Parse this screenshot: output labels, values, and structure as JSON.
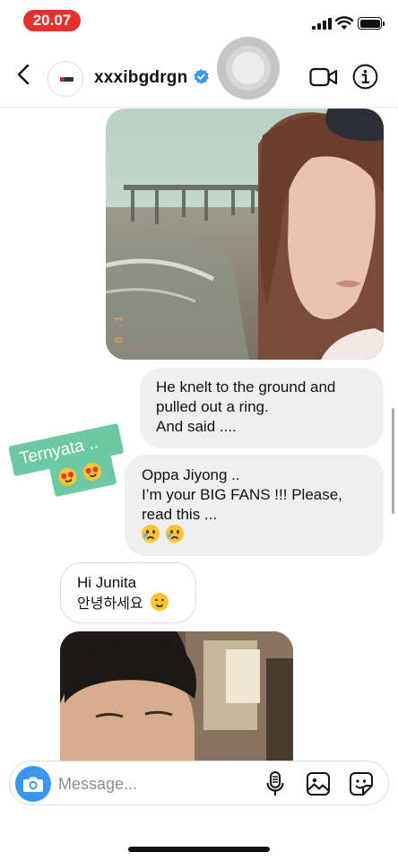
{
  "status_bar": {
    "time": "20.07",
    "icons": [
      "cellular-signal-icon",
      "wifi-icon",
      "battery-icon"
    ]
  },
  "header": {
    "username": "xxxibgdrgn",
    "verified": true,
    "icons": [
      "back-chevron-icon",
      "verified-badge-icon",
      "video-call-icon",
      "info-icon"
    ]
  },
  "messages": {
    "photo_1": {
      "type": "image",
      "description_icon": "photo-message",
      "stamp": "8 .1"
    },
    "bubble_1": {
      "line1": "He knelt to the ground and",
      "line2": "pulled out a ring.",
      "line3": "And said ...."
    },
    "sticker": {
      "text": "Ternyata ..",
      "emoji": [
        "heart-eyes",
        "heart-eyes"
      ]
    },
    "bubble_2": {
      "line1": "Oppa Jiyong ..",
      "line2": "I’m your BIG FANS !!! Please,",
      "line3": "read this ...",
      "emoji": [
        "crying-face",
        "crying-face"
      ]
    },
    "bubble_3": {
      "line1": "Hi Junita",
      "line2": "안녕하세요",
      "emoji": [
        "smiling-face"
      ]
    },
    "photo_2": {
      "type": "image",
      "description_icon": "photo-message"
    }
  },
  "composer": {
    "placeholder": "Message...",
    "value": "",
    "icons": [
      "camera-icon",
      "microphone-icon",
      "gallery-icon",
      "sticker-icon"
    ]
  },
  "colors": {
    "status_pill": "#e5302e",
    "accent_blue": "#3897f0",
    "sticker_green": "#6dc9a4",
    "outgoing_bubble": "#efefef"
  }
}
